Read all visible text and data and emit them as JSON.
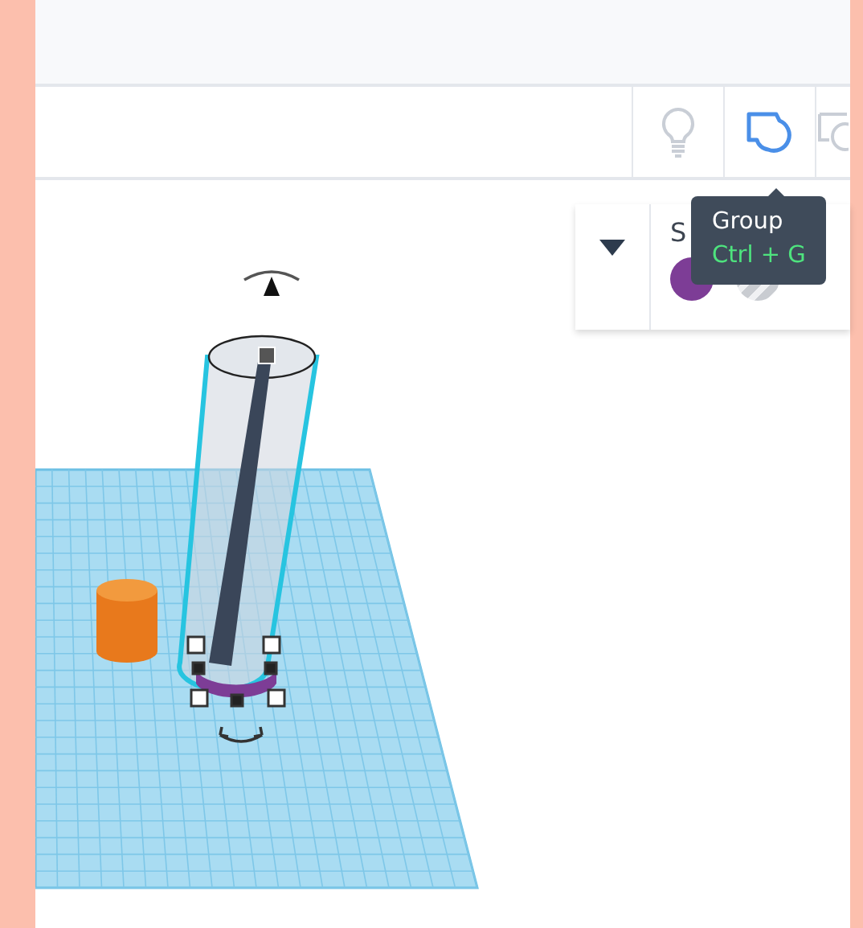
{
  "toolbar": {
    "tools": [
      {
        "kind": "bulb"
      },
      {
        "kind": "group"
      },
      {
        "kind": "ungroup"
      }
    ]
  },
  "tooltip": {
    "title": "Group",
    "shortcut": "Ctrl + G"
  },
  "shape_panel": {
    "title": "S",
    "swatches": [
      {
        "kind": "solid",
        "color": "#7d3d96"
      },
      {
        "kind": "hole"
      }
    ]
  },
  "scene": {
    "kind": "workplane"
  }
}
